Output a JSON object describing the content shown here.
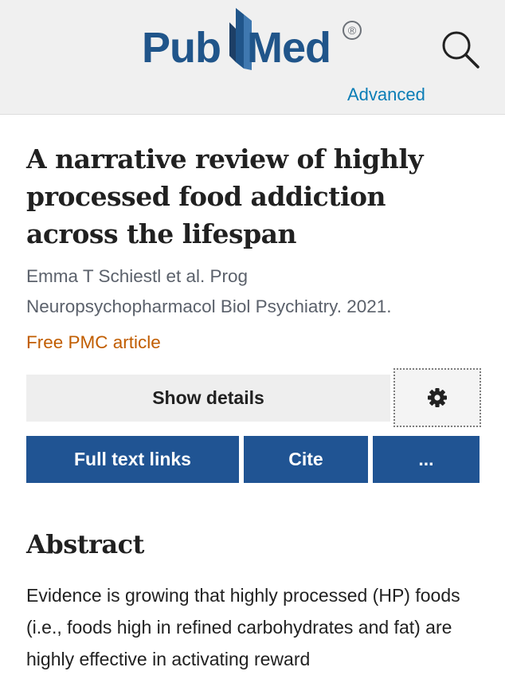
{
  "header": {
    "logo_pub": "Pub",
    "logo_med": "Med",
    "logo_reg": "®",
    "logo_sub": "Advanced",
    "search_icon": "search-icon"
  },
  "article": {
    "title": "A narrative review of highly processed food addiction across the lifespan",
    "authors": "Emma T Schiestl et al. Prog",
    "journal": "Neuropsychopharmacol Biol Psychiatry. 2021.",
    "free_pmc": "Free PMC article"
  },
  "actions": {
    "show_details": "Show details",
    "settings_icon": "gear-icon",
    "full_text_links": "Full text links",
    "cite": "Cite",
    "more": "..."
  },
  "abstract": {
    "heading": "Abstract",
    "text": "Evidence is growing that highly processed (HP) foods (i.e., foods high in refined carbohydrates and fat) are highly effective in activating reward"
  },
  "colors": {
    "brand": "#20558a",
    "button": "#205493",
    "link_orange": "#c15d00",
    "advanced": "#0a7db6"
  }
}
